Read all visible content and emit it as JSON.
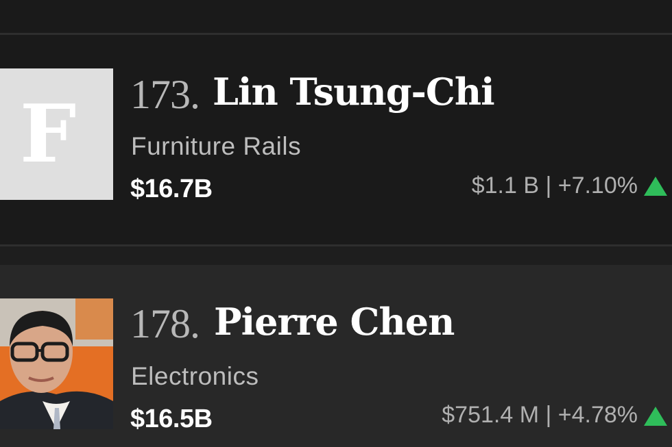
{
  "list": {
    "items": [
      {
        "rank": "173.",
        "name": "Lin Tsung-Chi",
        "source": "Furniture Rails",
        "net_worth": "$16.7B",
        "change": "$1.1 B | +7.10%",
        "photo_placeholder_letter": "F",
        "trend_icon": "up-arrow-icon",
        "trend_color": "#2fbd5a"
      },
      {
        "rank": "178.",
        "name": "Pierre Chen",
        "source": "Electronics",
        "net_worth": "$16.5B",
        "change": "$751.4 M | +4.78%",
        "trend_icon": "up-arrow-icon",
        "trend_color": "#2fbd5a"
      }
    ]
  }
}
